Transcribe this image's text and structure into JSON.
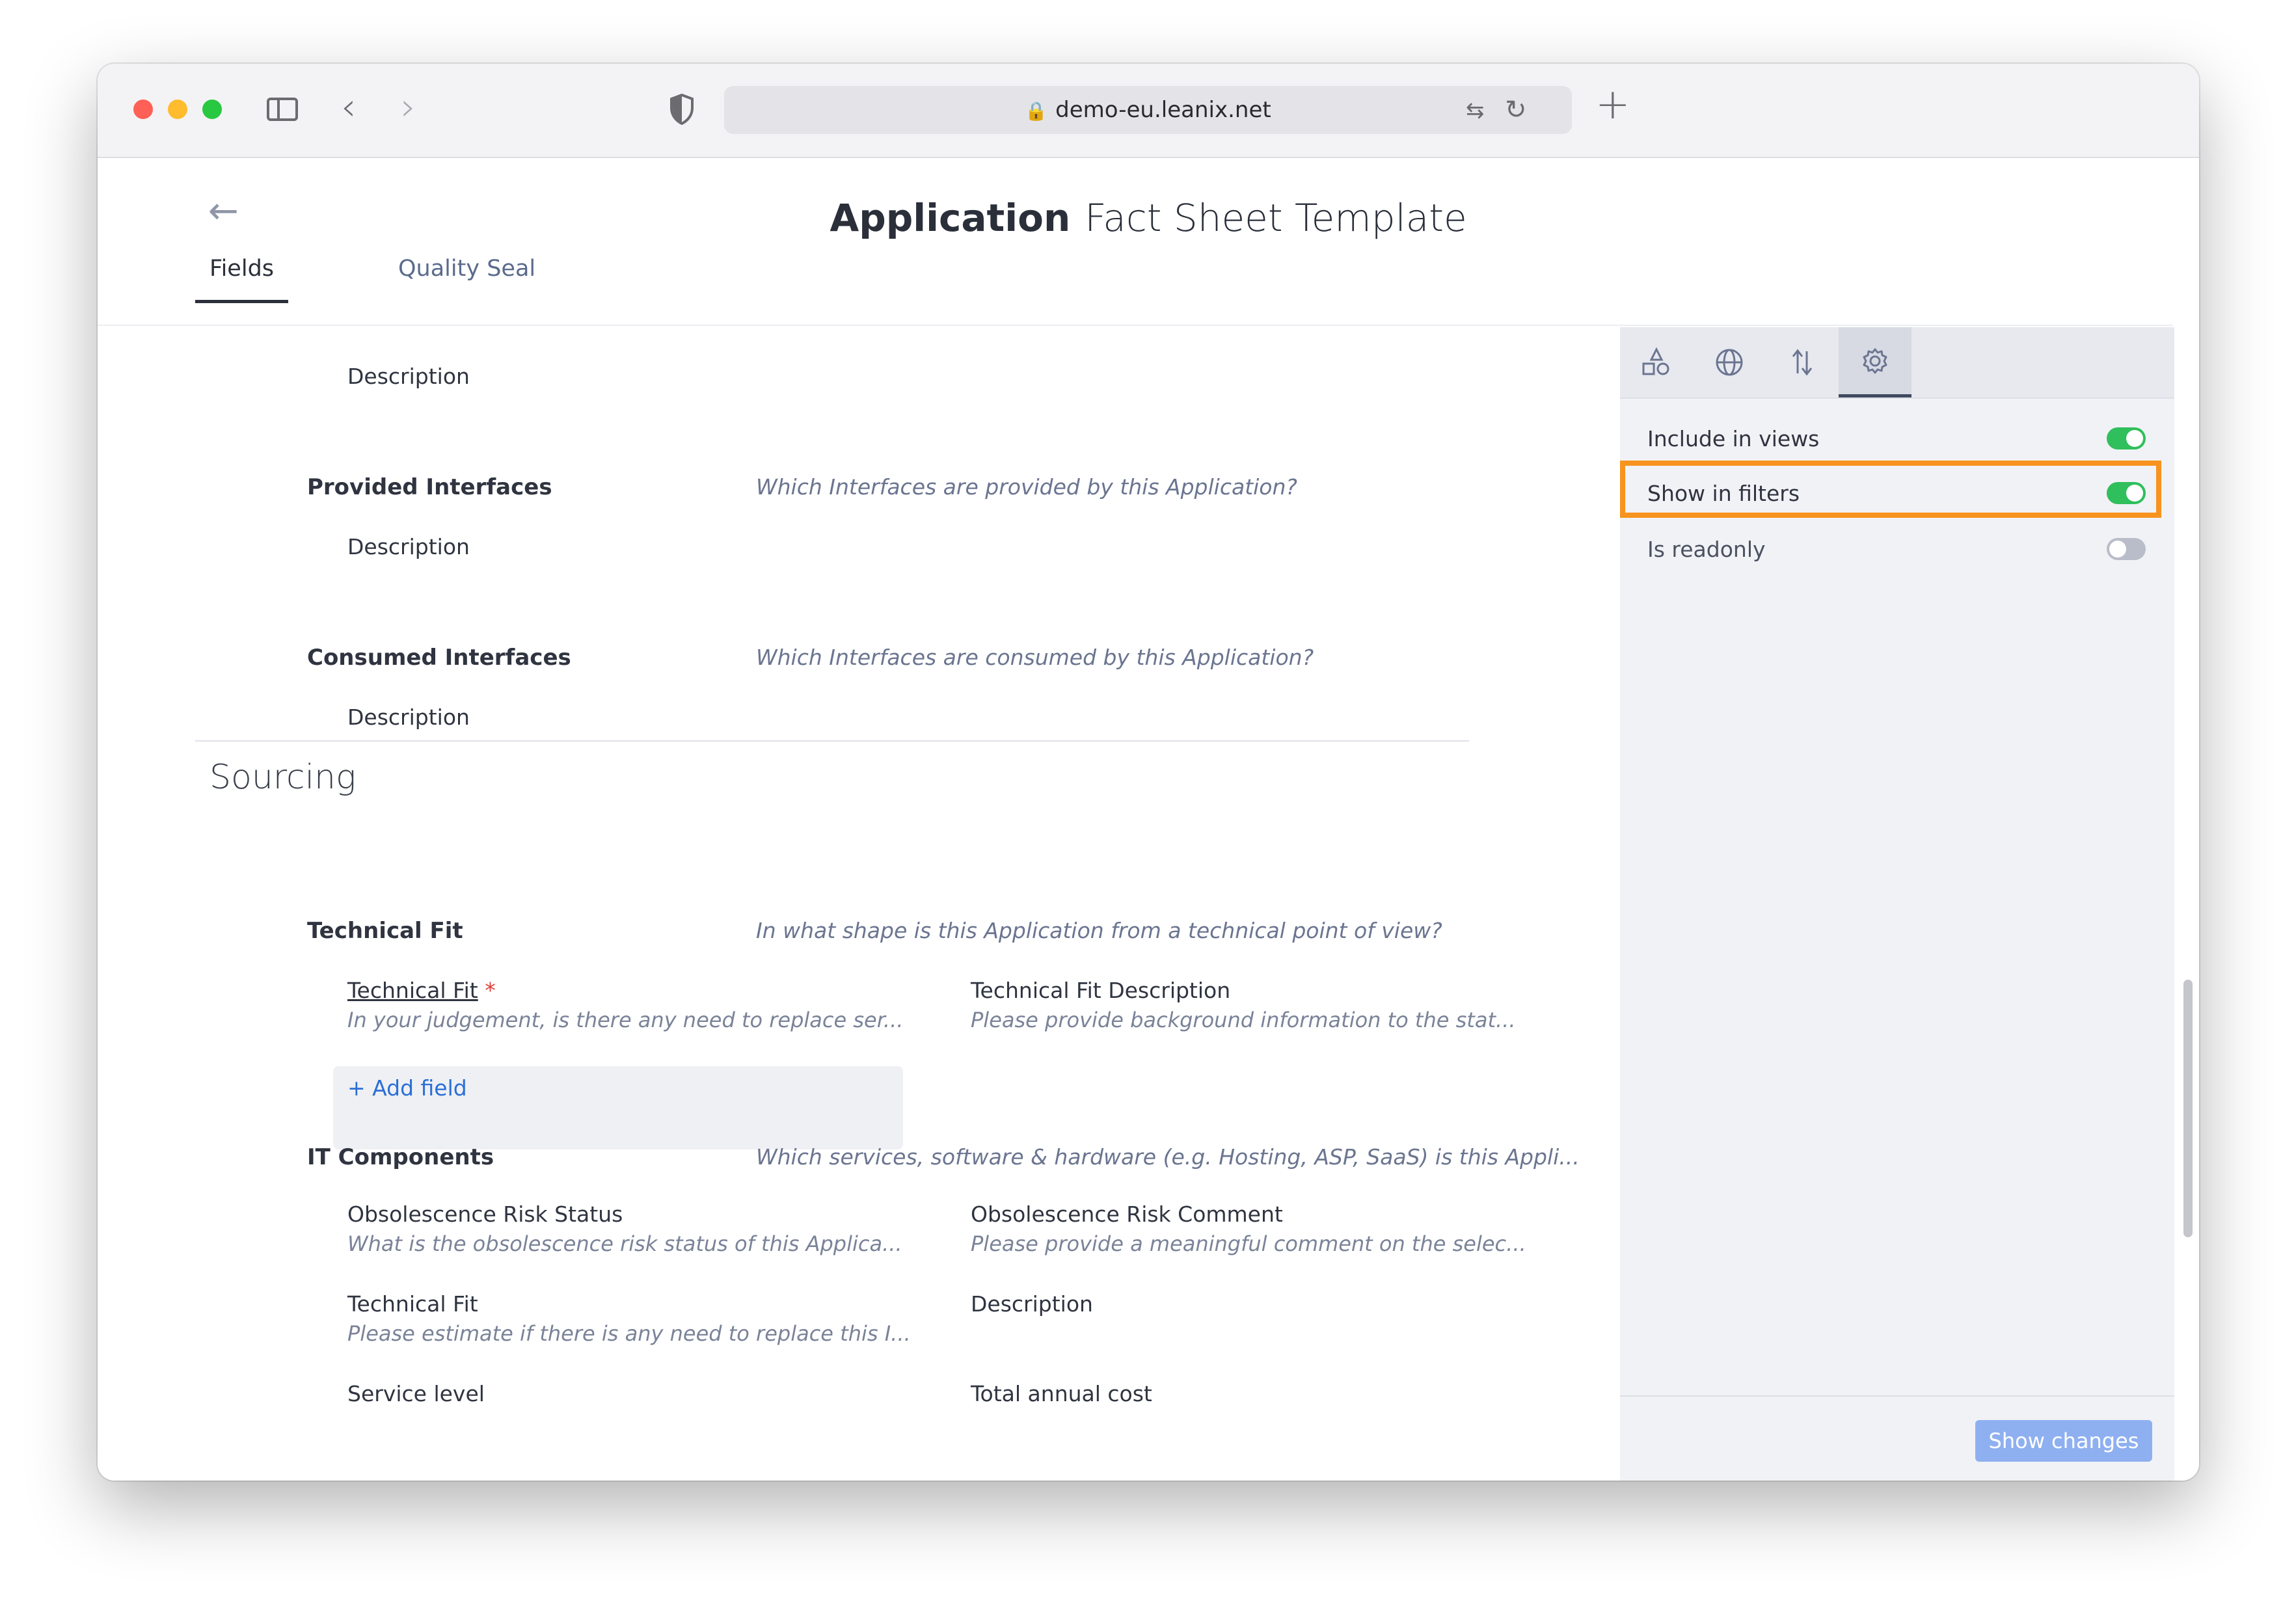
{
  "browser": {
    "url": "demo-eu.leanix.net"
  },
  "page": {
    "title_bold": "Application",
    "title_rest": "Fact Sheet Template",
    "tabs": [
      {
        "label": "Fields",
        "active": true
      },
      {
        "label": "Quality Seal",
        "active": false
      }
    ]
  },
  "fields": {
    "top_description": "Description",
    "provided_interfaces": {
      "title": "Provided Interfaces",
      "question": "Which Interfaces are provided by this Application?",
      "sub_label": "Description"
    },
    "consumed_interfaces": {
      "title": "Consumed Interfaces",
      "question": "Which Interfaces are consumed by this Application?",
      "sub_label": "Description"
    },
    "sourcing": {
      "title": "Sourcing",
      "technical_fit": {
        "title": "Technical Fit",
        "question": "In what shape is this Application from a technical point of view?",
        "field_left_label": "Technical Fit",
        "field_left_required": "*",
        "field_left_desc": "In your judgement, is there any need to replace ser...",
        "field_right_label": "Technical Fit Description",
        "field_right_desc": "Please provide background information to the stat...",
        "add_field": "+ Add field"
      },
      "it_components": {
        "title": "IT Components",
        "question": "Which services, software & hardware (e.g. Hosting, ASP, SaaS) is this Appli...",
        "items": [
          {
            "label": "Obsolescence Risk Status",
            "desc": "What is the obsolescence risk status of this Applica..."
          },
          {
            "label": "Obsolescence Risk Comment",
            "desc": "Please provide a meaningful comment on the selec..."
          },
          {
            "label": "Technical Fit",
            "desc": "Please estimate if there is any need to replace this I..."
          },
          {
            "label": "Description",
            "desc": ""
          },
          {
            "label": "Service level",
            "desc": ""
          },
          {
            "label": "Total annual cost",
            "desc": ""
          }
        ]
      }
    }
  },
  "panel": {
    "tab_icons": [
      "shapes-icon",
      "globe-icon",
      "sort-icon",
      "gear-icon"
    ],
    "active_tab": "gear-icon",
    "settings": [
      {
        "label": "Include in views",
        "on": true
      },
      {
        "label": "Show in filters",
        "on": true,
        "highlighted": true
      },
      {
        "label": "Is readonly",
        "on": false
      }
    ],
    "show_changes": "Show changes"
  },
  "colors": {
    "highlight": "#f7931e",
    "toggle_on": "#2fbf5c",
    "toggle_off": "#b8bdc9",
    "link": "#2b6fd6",
    "button": "#8fb0f0"
  }
}
